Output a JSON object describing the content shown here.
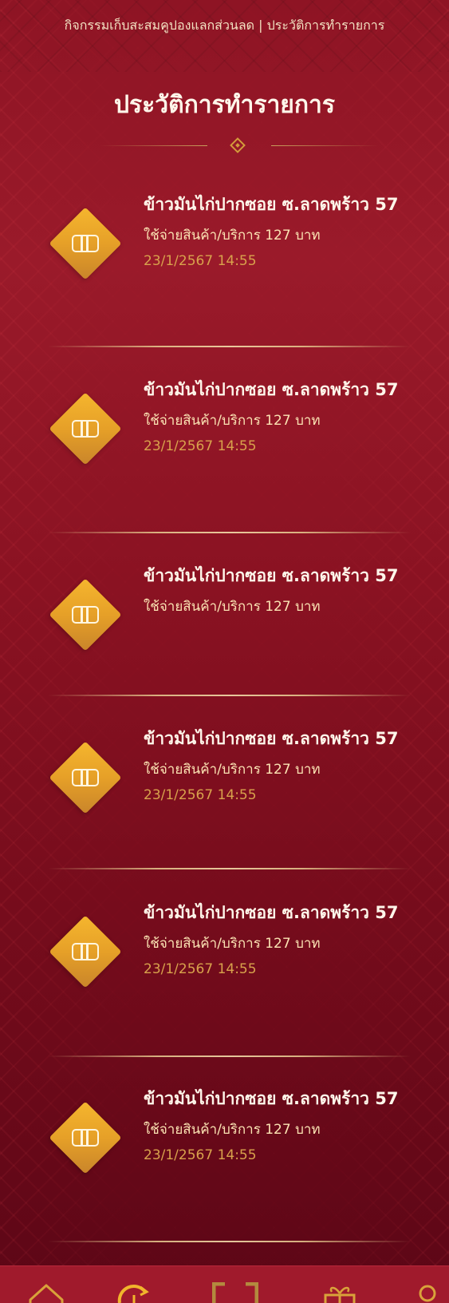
{
  "header": {
    "breadcrumb": "กิจกรรมเก็บสะสมคูปองแลกส่วนลด | ประวัติการทำรายการ",
    "title": "ประวัติการทำรายการ"
  },
  "transactions": [
    {
      "title": "ข้าวมันไก่ปากซอย ซ.ลาดพร้าว 57",
      "description": "ใช้จ่ายสินค้า/บริการ 127 บาท",
      "date": "23/1/2567 14:55"
    },
    {
      "title": "ข้าวมันไก่ปากซอย ซ.ลาดพร้าว 57",
      "description": "ใช้จ่ายสินค้า/บริการ 127 บาท",
      "date": "23/1/2567 14:55"
    },
    {
      "title": "ข้าวมันไก่ปากซอย ซ.ลาดพร้าว 57",
      "description": "ใช้จ่ายสินค้า/บริการ 127 บาท",
      "date": ""
    },
    {
      "title": "ข้าวมันไก่ปากซอย ซ.ลาดพร้าว 57",
      "description": "ใช้จ่ายสินค้า/บริการ 127 บาท",
      "date": "23/1/2567 14:55"
    },
    {
      "title": "ข้าวมันไก่ปากซอย ซ.ลาดพร้าว 57",
      "description": "ใช้จ่ายสินค้า/บริการ 127 บาท",
      "date": "23/1/2567 14:55"
    },
    {
      "title": "ข้าวมันไก่ปากซอย ซ.ลาดพร้าว 57",
      "description": "ใช้จ่ายสินค้า/บริการ 127 บาท",
      "date": "23/1/2567 14:55"
    }
  ],
  "icons": {
    "item": "coupon-ticket-icon",
    "nav": [
      "home-icon",
      "history-icon",
      "scan-icon",
      "gift-icon",
      "profile-icon"
    ]
  },
  "colors": {
    "background": "#8e1424",
    "accent_gold": "#e6a028",
    "date_text": "#d8a24c",
    "nav_bar": "#a01a2c"
  }
}
